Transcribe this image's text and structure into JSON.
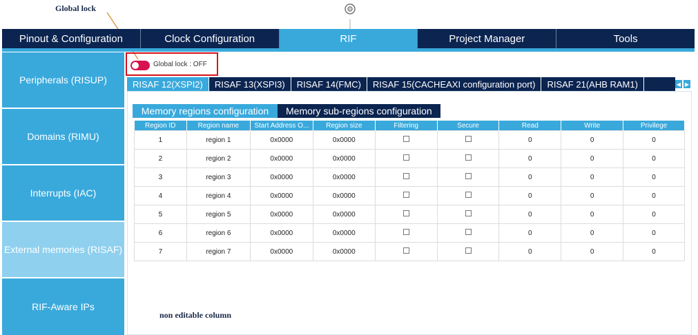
{
  "annotations": {
    "global_lock": "Global lock",
    "non_editable": "non editable column"
  },
  "top_nav": {
    "tabs": [
      "Pinout & Configuration",
      "Clock Configuration",
      "RIF",
      "Project Manager",
      "Tools"
    ],
    "active_index": 2
  },
  "sidebar": {
    "items": [
      "Peripherals (RISUP)",
      "Domains (RIMU)",
      "Interrupts (IAC)",
      "External memories (RISAF)",
      "RIF-Aware IPs"
    ],
    "selected_index": 3
  },
  "global_lock": {
    "label": "Global lock : OFF"
  },
  "subtabs": [
    "RISAF 12(XSPI2)",
    "RISAF 13(XSPI3)",
    "RISAF 14(FMC)",
    "RISAF 15(CACHEAXI configuration port)",
    "RISAF 21(AHB RAM1)"
  ],
  "inner_tabs": [
    "Memory regions configuration",
    "Memory sub-regions configuration"
  ],
  "table": {
    "headers": [
      "Region ID",
      "Region name",
      "Start Address O...",
      "Region size",
      "Filtering",
      "Secure",
      "Read",
      "Write",
      "Privilege"
    ],
    "rows": [
      {
        "id": "1",
        "name": "region 1",
        "start": "0x0000",
        "size": "0x0000",
        "read": "0",
        "write": "0",
        "privilege": "0"
      },
      {
        "id": "2",
        "name": "region 2",
        "start": "0x0000",
        "size": "0x0000",
        "read": "0",
        "write": "0",
        "privilege": "0"
      },
      {
        "id": "3",
        "name": "region 3",
        "start": "0x0000",
        "size": "0x0000",
        "read": "0",
        "write": "0",
        "privilege": "0"
      },
      {
        "id": "4",
        "name": "region 4",
        "start": "0x0000",
        "size": "0x0000",
        "read": "0",
        "write": "0",
        "privilege": "0"
      },
      {
        "id": "5",
        "name": "region 5",
        "start": "0x0000",
        "size": "0x0000",
        "read": "0",
        "write": "0",
        "privilege": "0"
      },
      {
        "id": "6",
        "name": "region 6",
        "start": "0x0000",
        "size": "0x0000",
        "read": "0",
        "write": "0",
        "privilege": "0"
      },
      {
        "id": "7",
        "name": "region 7",
        "start": "0x0000",
        "size": "0x0000",
        "read": "0",
        "write": "0",
        "privilege": "0"
      }
    ]
  },
  "colors": {
    "navy": "#0b2450",
    "accent_blue": "#39a9dc",
    "selected_blue": "#8fd0ee",
    "highlight_red": "#d8121a",
    "toggle_pink": "#d8124f",
    "arrow_green": "#2e9a3a",
    "leader_orange": "#d98a2b"
  },
  "icons": {
    "top_center": "settings-gear-icon",
    "scroll_left": "arrow-left-icon",
    "scroll_right": "arrow-right-icon"
  }
}
